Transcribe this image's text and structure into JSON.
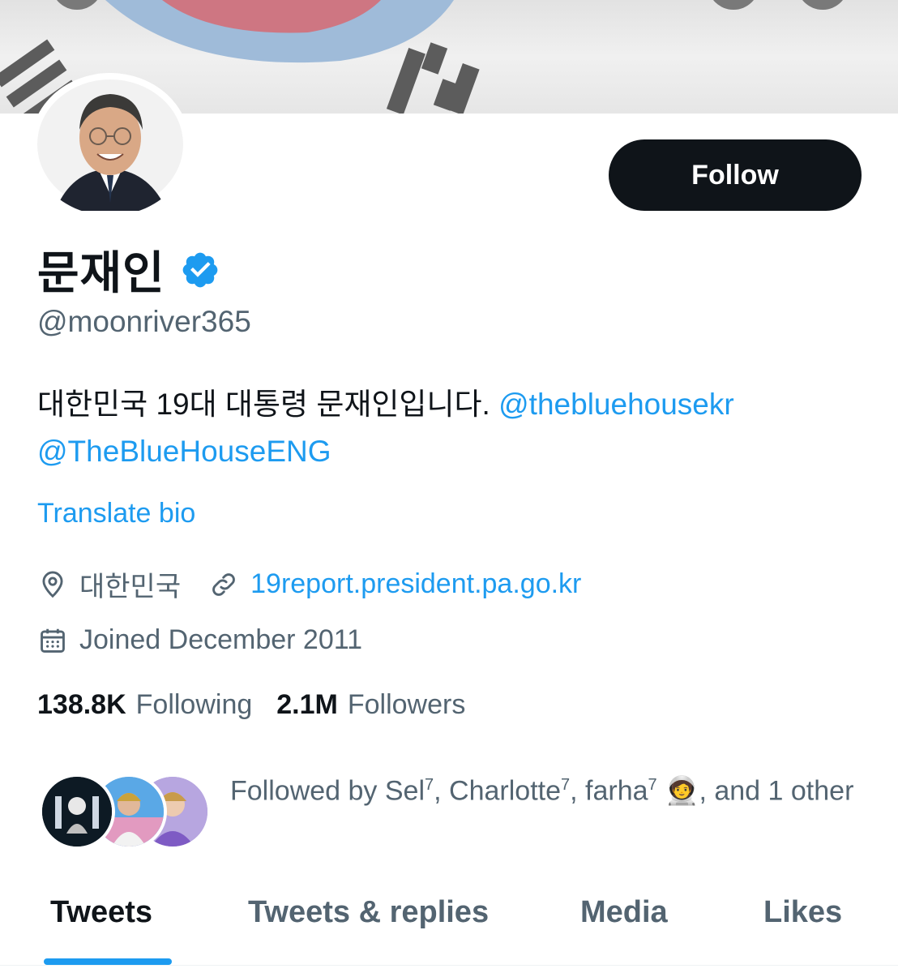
{
  "profile": {
    "display_name": "문재인",
    "handle": "@moonriver365",
    "bio_text": "대한민국 19대 대통령 문재인입니다. ",
    "bio_mention_1": "@thebluehousekr",
    "bio_mention_2": "@TheBlueHouseENG",
    "translate_label": "Translate bio",
    "location": "대한민국",
    "website": "19report.president.pa.go.kr",
    "joined": "Joined December 2011",
    "following_count": "138.8K",
    "following_label": "Following",
    "followers_count": "2.1M",
    "followers_label": "Followers"
  },
  "actions": {
    "follow_label": "Follow"
  },
  "followed_by": {
    "prefix": "Followed by ",
    "name_1": "Sel",
    "name_2": "Charlotte",
    "name_3": "farha",
    "superscript": "7",
    "emoji": "🧑‍🚀",
    "suffix": ", and 1 other"
  },
  "tabs": [
    {
      "label": "Tweets"
    },
    {
      "label": "Tweets & replies"
    },
    {
      "label": "Media"
    },
    {
      "label": "Likes"
    }
  ],
  "colors": {
    "accent": "#1d9bf0",
    "text_primary": "#0f1419",
    "text_secondary": "#536471",
    "follow_button_bg": "#0f1419"
  },
  "icons": {
    "verified": "verified-badge-icon",
    "location": "location-pin-icon",
    "link": "link-icon",
    "calendar": "calendar-icon"
  }
}
